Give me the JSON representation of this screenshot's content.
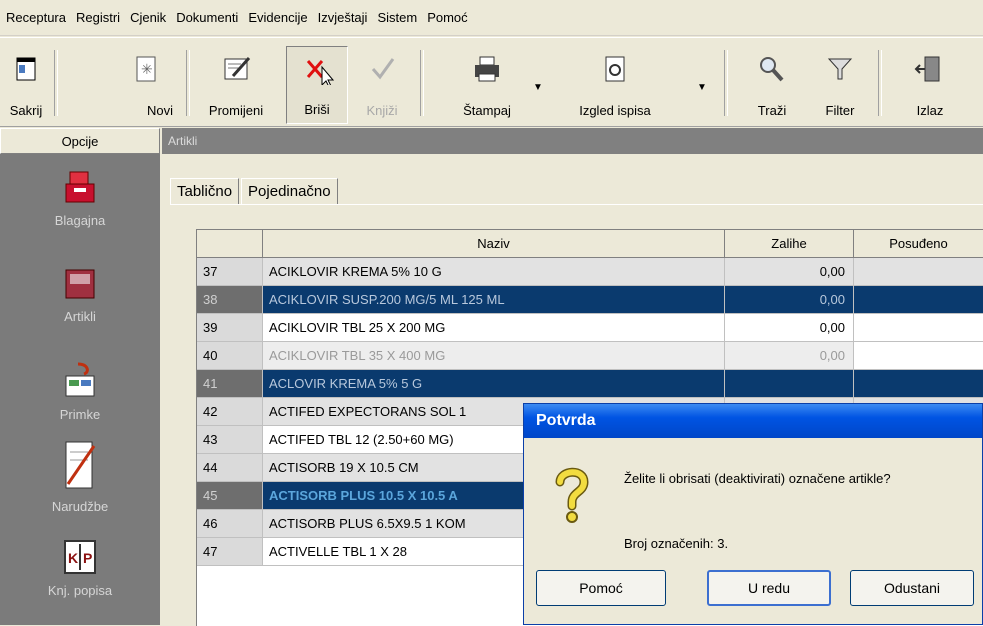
{
  "menu": [
    "Receptura",
    "Registri",
    "Cjenik",
    "Dokumenti",
    "Evidencije",
    "Izvještaji",
    "Sistem",
    "Pomoć"
  ],
  "toolbar": {
    "sakrij": "Sakrij",
    "novi": "Novi",
    "promijeni": "Promijeni",
    "brisi": "Briši",
    "knjizi": "Knjiži",
    "stampaj": "Štampaj",
    "izgled": "Izgled ispisa",
    "trazi": "Traži",
    "filter": "Filter",
    "izlaz": "Izlaz"
  },
  "left": {
    "header": "Opcije",
    "items": [
      "Blagajna",
      "Artikli",
      "Primke",
      "Narudžbe",
      "Knj. popisa"
    ]
  },
  "main": {
    "header": "Artikli",
    "tabs": [
      "Tablično",
      "Pojedinačno"
    ]
  },
  "grid": {
    "columns": [
      "",
      "Naziv",
      "Zalihe",
      "Posuđeno"
    ],
    "rows": [
      {
        "n": "37",
        "naziv": "ACIKLOVIR KREMA 5% 10 G",
        "zalihe": "0,00"
      },
      {
        "n": "38",
        "naziv": "ACIKLOVIR SUSP.200 MG/5 ML 125 ML",
        "zalihe": "0,00"
      },
      {
        "n": "39",
        "naziv": "ACIKLOVIR TBL 25 X 200 MG",
        "zalihe": "0,00"
      },
      {
        "n": "40",
        "naziv": "ACIKLOVIR TBL 35 X 400 MG",
        "zalihe": "0,00"
      },
      {
        "n": "41",
        "naziv": "ACLOVIR KREMA 5% 5 G",
        "zalihe": ""
      },
      {
        "n": "42",
        "naziv": "ACTIFED EXPECTORANS SOL 1",
        "zalihe": ""
      },
      {
        "n": "43",
        "naziv": "ACTIFED TBL 12 (2.50+60 MG)",
        "zalihe": ""
      },
      {
        "n": "44",
        "naziv": "ACTISORB 19 X 10.5 CM",
        "zalihe": ""
      },
      {
        "n": "45",
        "naziv": "ACTISORB PLUS 10.5 X 10.5 A",
        "zalihe": ""
      },
      {
        "n": "46",
        "naziv": "ACTISORB PLUS 6.5X9.5 1 KOM",
        "zalihe": ""
      },
      {
        "n": "47",
        "naziv": "ACTIVELLE TBL 1 X 28",
        "zalihe": ""
      }
    ]
  },
  "dialog": {
    "title": "Potvrda",
    "message": "Želite li obrisati (deaktivirati) označene artikle?",
    "count": "Broj označenih: 3.",
    "btn_help": "Pomoć",
    "btn_ok": "U redu",
    "btn_cancel": "Odustani"
  }
}
